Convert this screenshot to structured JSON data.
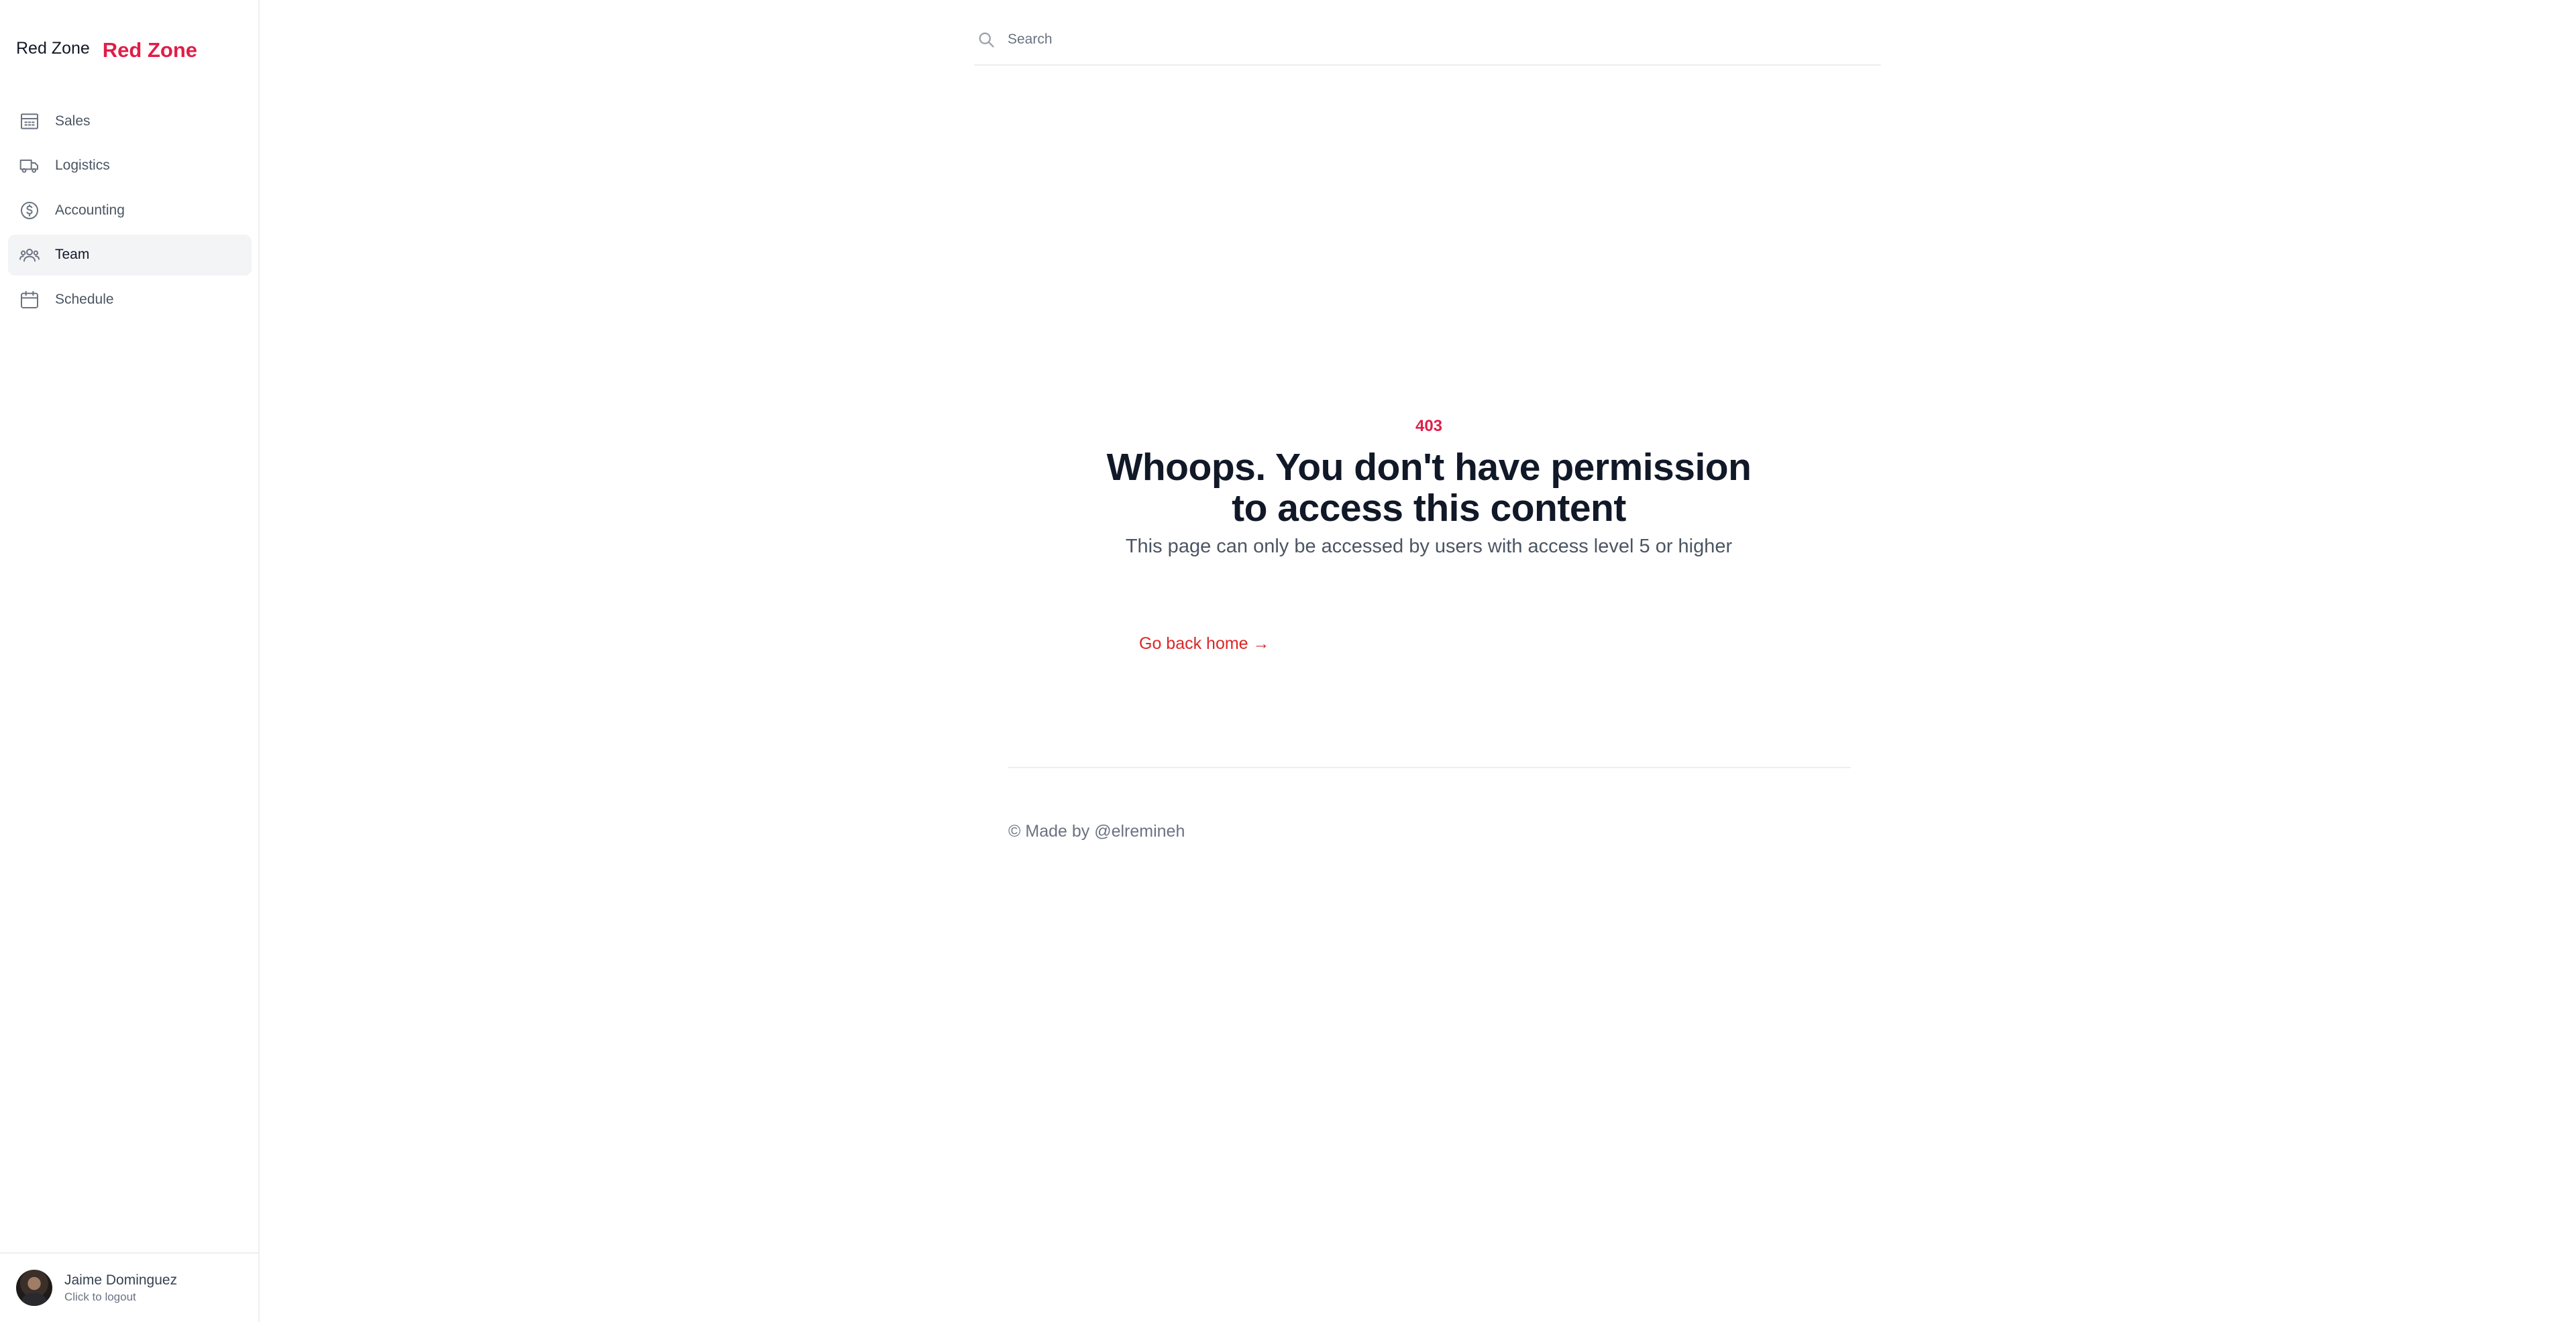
{
  "sidebar": {
    "brand_text": "Red Zone",
    "brand_strong": "Red Zone",
    "items": [
      {
        "label": "Sales",
        "icon": "building-icon",
        "active": false
      },
      {
        "label": "Logistics",
        "icon": "truck-icon",
        "active": false
      },
      {
        "label": "Accounting",
        "icon": "dollar-icon",
        "active": false
      },
      {
        "label": "Team",
        "icon": "users-icon",
        "active": true
      },
      {
        "label": "Schedule",
        "icon": "calendar-icon",
        "active": false
      }
    ],
    "user": {
      "name": "Jaime Dominguez",
      "subtitle": "Click to logout"
    }
  },
  "search": {
    "placeholder": "Search"
  },
  "error": {
    "code": "403",
    "title_line1": "Whoops. You don't have permission",
    "title_line2": "to access this content",
    "subtitle": "This page can only be accessed by users with access level 5 or higher",
    "link": "Go back home →"
  },
  "footer": {
    "text": "© Made by @elremineh"
  },
  "colors": {
    "accent": "#e11d48",
    "link": "#dc2626",
    "muted": "#6b7280"
  }
}
